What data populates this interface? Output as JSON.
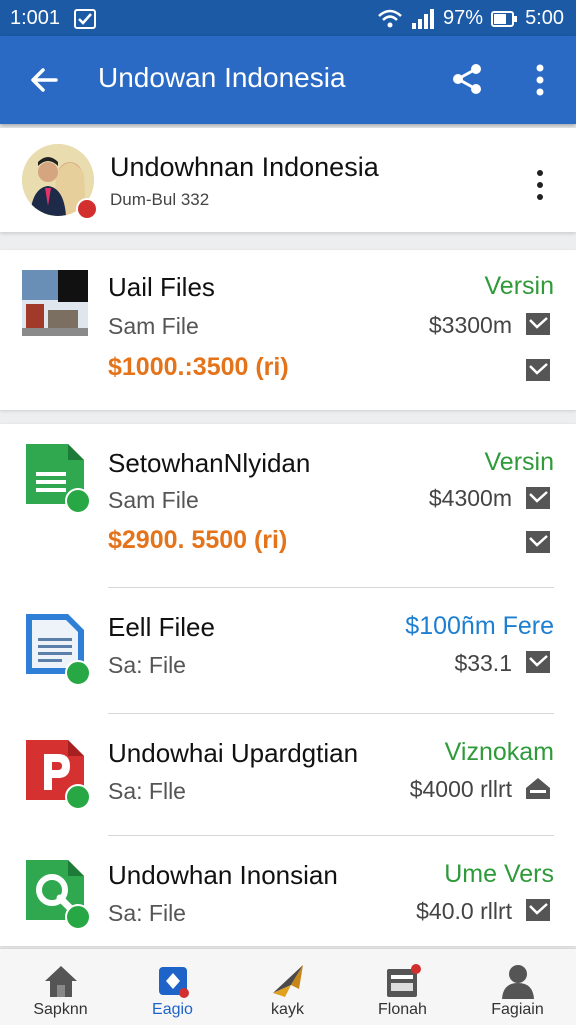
{
  "status_bar": {
    "time": "1:001",
    "battery": "97%",
    "clock": "5:00"
  },
  "app_bar": {
    "title": "Undowan Indonesia"
  },
  "profile": {
    "name": "Undowhnan Indonesia",
    "subtitle": "Dum-Bul 332"
  },
  "files": [
    {
      "title": "Uail Files",
      "subtitle": "Sam File",
      "price": "$1000.:3500 (ri)",
      "tag": "Versin",
      "tag_color": "#2e9a3a",
      "size": "$3300m",
      "icon": "image-thumbnail-icon"
    },
    {
      "title": "SetowhanNlyidan",
      "subtitle": "Sam File",
      "price": "$2900. 5500 (ri)",
      "tag": "Versin",
      "tag_color": "#2e9a3a",
      "size": "$4300m",
      "icon": "spreadsheet-file-icon"
    },
    {
      "title": "Eell Filee",
      "subtitle": "Sa: File",
      "tag": "$100ñm Fere",
      "tag_color": "#1e7fd0",
      "size": "$33.1",
      "icon": "document-file-icon"
    },
    {
      "title": "Undowhai Upardgtian",
      "subtitle": "Sa: Flle",
      "tag": "Viznokam",
      "tag_color": "#2e9a3a",
      "size": "$4000 rllrt",
      "icon": "presentation-file-icon"
    },
    {
      "title": "Undowhan Inonsian",
      "subtitle": "Sa: File",
      "tag": "Ume Vers",
      "tag_color": "#2e9a3a",
      "size": "$40.0 rllrt",
      "icon": "search-file-icon"
    }
  ],
  "bottom_nav": [
    {
      "label": "Sapknn",
      "icon": "home-icon",
      "active": false
    },
    {
      "label": "Eagio",
      "icon": "app-icon",
      "active": true
    },
    {
      "label": "kayk",
      "icon": "compass-icon",
      "active": false
    },
    {
      "label": "Flonah",
      "icon": "inbox-icon",
      "active": false
    },
    {
      "label": "Fagiain",
      "icon": "person-icon",
      "active": false
    }
  ],
  "colors": {
    "primary": "#2a6ac4",
    "status_bar": "#1c5aa6",
    "price_orange": "#e4731a",
    "green": "#2e9a3a",
    "blue_tag": "#1e7fd0"
  }
}
